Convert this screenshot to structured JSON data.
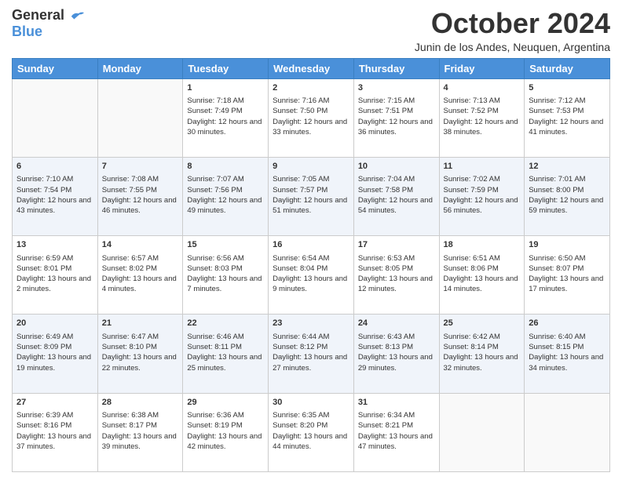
{
  "logo": {
    "line1": "General",
    "line2": "Blue"
  },
  "title": "October 2024",
  "subtitle": "Junin de los Andes, Neuquen, Argentina",
  "days": [
    "Sunday",
    "Monday",
    "Tuesday",
    "Wednesday",
    "Thursday",
    "Friday",
    "Saturday"
  ],
  "weeks": [
    [
      {
        "day": "",
        "sunrise": "",
        "sunset": "",
        "daylight": "",
        "empty": true
      },
      {
        "day": "",
        "sunrise": "",
        "sunset": "",
        "daylight": "",
        "empty": true
      },
      {
        "day": "1",
        "sunrise": "Sunrise: 7:18 AM",
        "sunset": "Sunset: 7:49 PM",
        "daylight": "Daylight: 12 hours and 30 minutes."
      },
      {
        "day": "2",
        "sunrise": "Sunrise: 7:16 AM",
        "sunset": "Sunset: 7:50 PM",
        "daylight": "Daylight: 12 hours and 33 minutes."
      },
      {
        "day": "3",
        "sunrise": "Sunrise: 7:15 AM",
        "sunset": "Sunset: 7:51 PM",
        "daylight": "Daylight: 12 hours and 36 minutes."
      },
      {
        "day": "4",
        "sunrise": "Sunrise: 7:13 AM",
        "sunset": "Sunset: 7:52 PM",
        "daylight": "Daylight: 12 hours and 38 minutes."
      },
      {
        "day": "5",
        "sunrise": "Sunrise: 7:12 AM",
        "sunset": "Sunset: 7:53 PM",
        "daylight": "Daylight: 12 hours and 41 minutes."
      }
    ],
    [
      {
        "day": "6",
        "sunrise": "Sunrise: 7:10 AM",
        "sunset": "Sunset: 7:54 PM",
        "daylight": "Daylight: 12 hours and 43 minutes."
      },
      {
        "day": "7",
        "sunrise": "Sunrise: 7:08 AM",
        "sunset": "Sunset: 7:55 PM",
        "daylight": "Daylight: 12 hours and 46 minutes."
      },
      {
        "day": "8",
        "sunrise": "Sunrise: 7:07 AM",
        "sunset": "Sunset: 7:56 PM",
        "daylight": "Daylight: 12 hours and 49 minutes."
      },
      {
        "day": "9",
        "sunrise": "Sunrise: 7:05 AM",
        "sunset": "Sunset: 7:57 PM",
        "daylight": "Daylight: 12 hours and 51 minutes."
      },
      {
        "day": "10",
        "sunrise": "Sunrise: 7:04 AM",
        "sunset": "Sunset: 7:58 PM",
        "daylight": "Daylight: 12 hours and 54 minutes."
      },
      {
        "day": "11",
        "sunrise": "Sunrise: 7:02 AM",
        "sunset": "Sunset: 7:59 PM",
        "daylight": "Daylight: 12 hours and 56 minutes."
      },
      {
        "day": "12",
        "sunrise": "Sunrise: 7:01 AM",
        "sunset": "Sunset: 8:00 PM",
        "daylight": "Daylight: 12 hours and 59 minutes."
      }
    ],
    [
      {
        "day": "13",
        "sunrise": "Sunrise: 6:59 AM",
        "sunset": "Sunset: 8:01 PM",
        "daylight": "Daylight: 13 hours and 2 minutes."
      },
      {
        "day": "14",
        "sunrise": "Sunrise: 6:57 AM",
        "sunset": "Sunset: 8:02 PM",
        "daylight": "Daylight: 13 hours and 4 minutes."
      },
      {
        "day": "15",
        "sunrise": "Sunrise: 6:56 AM",
        "sunset": "Sunset: 8:03 PM",
        "daylight": "Daylight: 13 hours and 7 minutes."
      },
      {
        "day": "16",
        "sunrise": "Sunrise: 6:54 AM",
        "sunset": "Sunset: 8:04 PM",
        "daylight": "Daylight: 13 hours and 9 minutes."
      },
      {
        "day": "17",
        "sunrise": "Sunrise: 6:53 AM",
        "sunset": "Sunset: 8:05 PM",
        "daylight": "Daylight: 13 hours and 12 minutes."
      },
      {
        "day": "18",
        "sunrise": "Sunrise: 6:51 AM",
        "sunset": "Sunset: 8:06 PM",
        "daylight": "Daylight: 13 hours and 14 minutes."
      },
      {
        "day": "19",
        "sunrise": "Sunrise: 6:50 AM",
        "sunset": "Sunset: 8:07 PM",
        "daylight": "Daylight: 13 hours and 17 minutes."
      }
    ],
    [
      {
        "day": "20",
        "sunrise": "Sunrise: 6:49 AM",
        "sunset": "Sunset: 8:09 PM",
        "daylight": "Daylight: 13 hours and 19 minutes."
      },
      {
        "day": "21",
        "sunrise": "Sunrise: 6:47 AM",
        "sunset": "Sunset: 8:10 PM",
        "daylight": "Daylight: 13 hours and 22 minutes."
      },
      {
        "day": "22",
        "sunrise": "Sunrise: 6:46 AM",
        "sunset": "Sunset: 8:11 PM",
        "daylight": "Daylight: 13 hours and 25 minutes."
      },
      {
        "day": "23",
        "sunrise": "Sunrise: 6:44 AM",
        "sunset": "Sunset: 8:12 PM",
        "daylight": "Daylight: 13 hours and 27 minutes."
      },
      {
        "day": "24",
        "sunrise": "Sunrise: 6:43 AM",
        "sunset": "Sunset: 8:13 PM",
        "daylight": "Daylight: 13 hours and 29 minutes."
      },
      {
        "day": "25",
        "sunrise": "Sunrise: 6:42 AM",
        "sunset": "Sunset: 8:14 PM",
        "daylight": "Daylight: 13 hours and 32 minutes."
      },
      {
        "day": "26",
        "sunrise": "Sunrise: 6:40 AM",
        "sunset": "Sunset: 8:15 PM",
        "daylight": "Daylight: 13 hours and 34 minutes."
      }
    ],
    [
      {
        "day": "27",
        "sunrise": "Sunrise: 6:39 AM",
        "sunset": "Sunset: 8:16 PM",
        "daylight": "Daylight: 13 hours and 37 minutes."
      },
      {
        "day": "28",
        "sunrise": "Sunrise: 6:38 AM",
        "sunset": "Sunset: 8:17 PM",
        "daylight": "Daylight: 13 hours and 39 minutes."
      },
      {
        "day": "29",
        "sunrise": "Sunrise: 6:36 AM",
        "sunset": "Sunset: 8:19 PM",
        "daylight": "Daylight: 13 hours and 42 minutes."
      },
      {
        "day": "30",
        "sunrise": "Sunrise: 6:35 AM",
        "sunset": "Sunset: 8:20 PM",
        "daylight": "Daylight: 13 hours and 44 minutes."
      },
      {
        "day": "31",
        "sunrise": "Sunrise: 6:34 AM",
        "sunset": "Sunset: 8:21 PM",
        "daylight": "Daylight: 13 hours and 47 minutes."
      },
      {
        "day": "",
        "sunrise": "",
        "sunset": "",
        "daylight": "",
        "empty": true
      },
      {
        "day": "",
        "sunrise": "",
        "sunset": "",
        "daylight": "",
        "empty": true
      }
    ]
  ]
}
